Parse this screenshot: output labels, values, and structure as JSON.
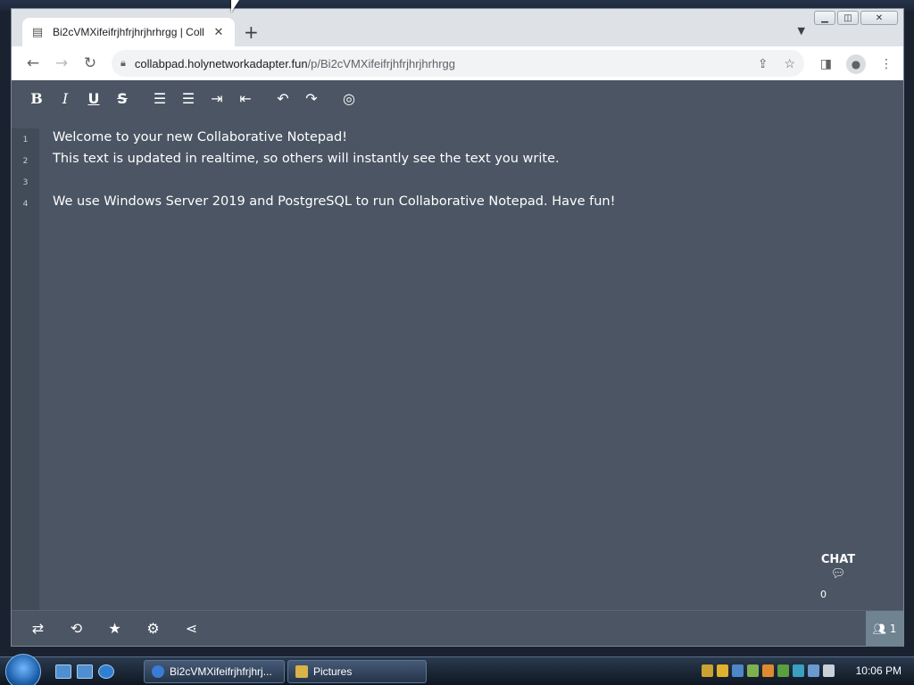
{
  "browser": {
    "tab_title": "Bi2cVMXifeifrjhfrjhrjhrhrgg | Coll",
    "url_host": "collabpad.holynetworkadapter.fun",
    "url_path": "/p/Bi2cVMXifeifrjhfrjhrjhrhrgg"
  },
  "editor": {
    "lines": [
      {
        "num": "1",
        "text": "Welcome to your new Collaborative Notepad!"
      },
      {
        "num": "2",
        "text": "This text is updated in realtime, so others will instantly see the text you write."
      },
      {
        "num": "3",
        "text": ""
      },
      {
        "num": "4",
        "text": "We use Windows Server 2019 and PostgreSQL to run Collaborative Notepad. Have fun!"
      }
    ]
  },
  "toolbar_buttons": {
    "bold": "B",
    "italic": "I",
    "underline": "U",
    "strike": "S"
  },
  "chat": {
    "label": "CHAT",
    "count": "0"
  },
  "users": {
    "count": "1"
  },
  "taskbar": {
    "items": [
      "Bi2cVMXifeifrjhfrjhrj...",
      "Pictures"
    ],
    "clock": "10:06 PM"
  },
  "icons": {
    "ordered_list": "ordered-list-icon",
    "unordered_list": "unordered-list-icon",
    "indent": "indent-icon",
    "outdent": "outdent-icon",
    "undo": "undo-icon",
    "redo": "redo-icon",
    "hide": "eye-slash-icon"
  }
}
